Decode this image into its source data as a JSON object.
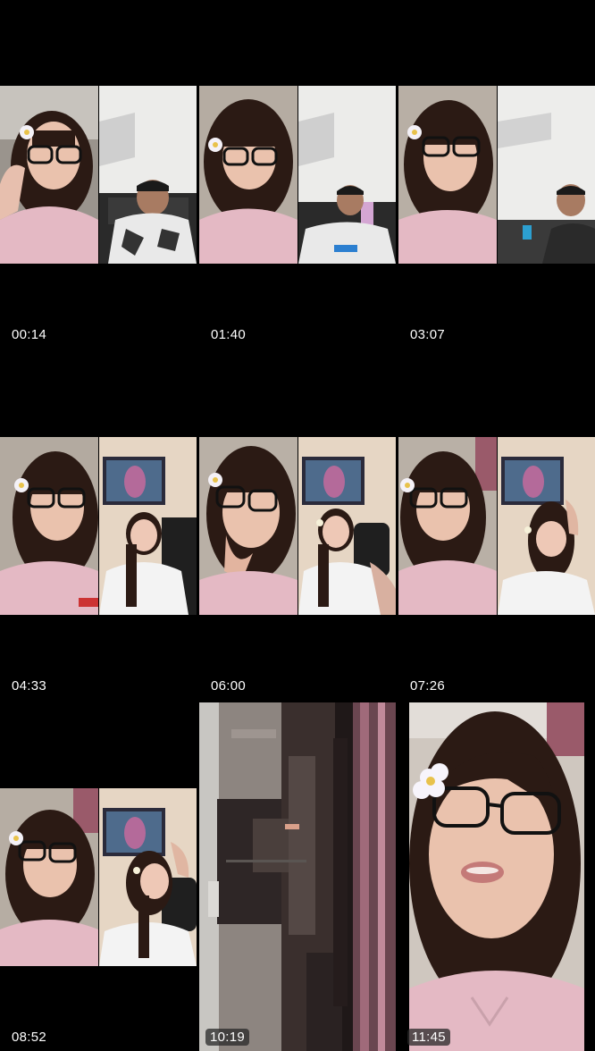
{
  "thumbnails": [
    {
      "timestamp": "00:14",
      "layout": "split-room-man"
    },
    {
      "timestamp": "01:40",
      "layout": "split-room-man"
    },
    {
      "timestamp": "03:07",
      "layout": "split-room-man"
    },
    {
      "timestamp": "04:33",
      "layout": "split-painting-woman"
    },
    {
      "timestamp": "06:00",
      "layout": "split-painting-woman"
    },
    {
      "timestamp": "07:26",
      "layout": "split-painting-woman"
    },
    {
      "timestamp": "08:52",
      "layout": "split-painting-woman"
    },
    {
      "timestamp": "10:19",
      "layout": "glitch"
    },
    {
      "timestamp": "11:45",
      "layout": "single-closeup"
    }
  ],
  "colors": {
    "background": "#000000",
    "pajama_pink": "#e4b9c4",
    "hair_dark": "#2b1a14",
    "skin": "#eac2ad",
    "wall_light": "#e9e9e7",
    "wall_beige": "#e6d6c4"
  }
}
